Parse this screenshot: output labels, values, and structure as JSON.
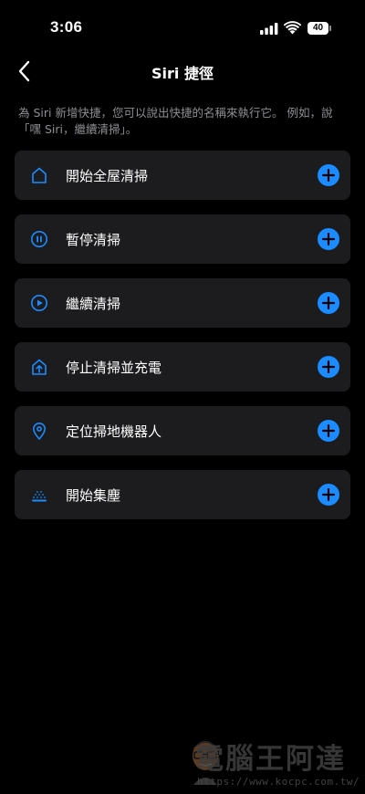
{
  "status_bar": {
    "time": "3:06",
    "battery": "40"
  },
  "nav": {
    "title": "Siri 捷徑"
  },
  "description": "為 Siri 新增快捷，您可以說出快捷的名稱來執行它。 例如，說「嘿 Siri，繼續清掃」。",
  "colors": {
    "accent": "#1a8cff",
    "card_bg": "#1c1c1e",
    "background": "#000000",
    "secondary_text": "#8e8e93"
  },
  "shortcuts": [
    {
      "label": "開始全屋清掃",
      "icon": "house-icon"
    },
    {
      "label": "暫停清掃",
      "icon": "pause-circle-icon"
    },
    {
      "label": "繼續清掃",
      "icon": "play-circle-icon"
    },
    {
      "label": "停止清掃並充電",
      "icon": "home-return-icon"
    },
    {
      "label": "定位掃地機器人",
      "icon": "location-pin-icon"
    },
    {
      "label": "開始集塵",
      "icon": "dust-collect-icon"
    }
  ],
  "watermark": {
    "title": "電腦王阿達",
    "url": "https://www.kocpc.com.tw/"
  }
}
